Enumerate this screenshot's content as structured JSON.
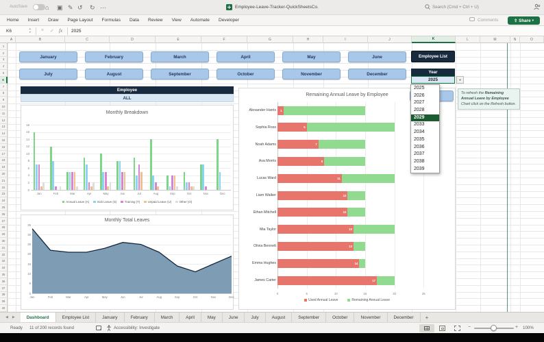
{
  "titlebar": {
    "autosave": "AutoSave",
    "title": "Employee-Leave-Tracker-QuickSheetsCo.",
    "search": "Search (Cmd + Ctrl + U)"
  },
  "ribbon": {
    "tabs": [
      "Home",
      "Insert",
      "Draw",
      "Page Layout",
      "Formulas",
      "Data",
      "Review",
      "View",
      "Automate",
      "Developer"
    ],
    "comments": "Comments",
    "share": "Share"
  },
  "formula_bar": {
    "cell_ref": "K6",
    "fx": "fx",
    "value": "2025"
  },
  "grid": {
    "columns": [
      "A",
      "B",
      "C",
      "D",
      "E",
      "F",
      "G",
      "H",
      "I",
      "J",
      "K",
      "L",
      "M",
      "N",
      "O"
    ],
    "rows": 40,
    "selected_column": "K",
    "selected_row": 6
  },
  "controls": {
    "month_buttons_row1": [
      "January",
      "February",
      "March",
      "April",
      "May",
      "June"
    ],
    "month_buttons_row2": [
      "July",
      "August",
      "September",
      "October",
      "November",
      "December"
    ],
    "employee_list_button": "Employee List",
    "year_label": "Year",
    "year_value": "2025",
    "year_options": [
      "2025",
      "2026",
      "2027",
      "2028",
      "2029",
      "2033",
      "2034",
      "2035",
      "2036",
      "2037",
      "2038",
      "2039"
    ],
    "year_selected_option": "2029",
    "refresh_note": {
      "pre": "To refresh the ",
      "bold": "Remaining Annual Leave by Employee",
      "post": " Chart click on the Refresh button."
    }
  },
  "employee_filter": {
    "header": "Employee",
    "value": "ALL"
  },
  "chart_data": [
    {
      "type": "bar",
      "title": "Monthly Breakdown",
      "categories": [
        "Jan",
        "Feb",
        "Mar",
        "Apr",
        "May",
        "Jun",
        "Jul",
        "Aug",
        "Sep",
        "Oct",
        "Nov",
        "Dec"
      ],
      "series": [
        {
          "name": "Annual Leave (A)",
          "color": "#7DD687",
          "values": [
            16,
            12,
            5,
            9,
            10,
            8,
            9,
            14,
            4,
            5,
            7,
            14
          ]
        },
        {
          "name": "Sick Leave (S)",
          "color": "#8FD2F4",
          "values": [
            7,
            8,
            5,
            7,
            5,
            8,
            4,
            4,
            1,
            2,
            7,
            5
          ]
        },
        {
          "name": "Training (T)",
          "color": "#D784D1",
          "values": [
            7,
            1,
            5,
            2,
            5,
            5,
            7,
            2,
            4,
            2,
            1,
            0
          ]
        },
        {
          "name": "Unpaid Leave (U)",
          "color": "#F3BF8C",
          "values": [
            1,
            0,
            5,
            1,
            1,
            5,
            5,
            1,
            4,
            1,
            0,
            0
          ]
        },
        {
          "name": "Other (O)",
          "color": "#DEDEDE",
          "values": [
            2,
            1,
            1,
            2,
            2,
            0,
            0,
            0,
            1,
            1,
            0,
            0
          ]
        }
      ],
      "ylim": [
        0,
        18
      ],
      "ytick_step": 2,
      "grid": true,
      "legend_position": "bottom"
    },
    {
      "type": "area",
      "title": "Monthly Total Leaves",
      "categories": [
        "Jan",
        "Feb",
        "Mar",
        "Apr",
        "May",
        "Jun",
        "Jul",
        "Aug",
        "Sep",
        "Oct",
        "Nov",
        "Dec"
      ],
      "values": [
        33,
        22,
        21,
        21,
        23,
        26,
        25,
        21,
        14,
        11,
        15,
        19
      ],
      "ylim": [
        0,
        35
      ],
      "ytick_step": 5,
      "grid": true,
      "fill_color": "#7E9CB4",
      "line_color": "#15293D"
    },
    {
      "type": "bar-horizontal-stacked",
      "title": "Remaining Annual Leave by Employee",
      "categories": [
        "Alexander Harris",
        "Sophia Ross",
        "Noah Adams",
        "Ava Morris",
        "Lucas Ward",
        "Liam Walker",
        "Ethan Mitchell",
        "Mia Taylor",
        "Olivia Bennett",
        "Emma Hughes",
        "James Carter"
      ],
      "series": [
        {
          "name": "Used Annual Leave",
          "color": "#E8756C",
          "values": [
            1,
            5,
            7,
            8,
            11,
            12,
            12,
            13,
            13,
            14,
            17
          ],
          "data_labels": true
        },
        {
          "name": "Remaining Annual Leave",
          "color": "#90DB8F",
          "values": [
            14,
            15,
            8,
            7,
            9,
            3,
            3,
            7,
            2,
            1,
            3
          ]
        }
      ],
      "xlim": [
        0,
        25
      ],
      "xtick_step": 5,
      "grid": true,
      "legend_position": "bottom"
    }
  ],
  "sheet_tabs": {
    "tabs": [
      "Dashboard",
      "Employee List",
      "January",
      "February",
      "March",
      "April",
      "May",
      "June",
      "July",
      "August",
      "September",
      "October",
      "November",
      "December"
    ],
    "active": "Dashboard",
    "add": "+"
  },
  "status_bar": {
    "mode": "Ready",
    "records": "11 of 200 records found",
    "accessibility": "Accessibility: Investigate",
    "zoom": "100%"
  },
  "icons": {
    "home": "⌂",
    "save": "▣",
    "edit": "✎",
    "undo": "↺",
    "redo": "↻",
    "more": "⋯",
    "stepper_up": "▲",
    "stepper_down": "▼",
    "cancel": "×",
    "enter": "✓",
    "dropdown_arrow": "▼",
    "tab_prev": "◀",
    "tab_next": "▶",
    "share_arrow": "▾",
    "share_glyph": "⇧",
    "zoom_minus": "−",
    "zoom_plus": "+"
  },
  "colors": {
    "excel_green": "#1E7145",
    "navy_header": "#182B3E",
    "month_button": "#A9C7E9",
    "all_row": "#D9E6F3",
    "selection_green": "#107C41",
    "dropdown_selected": "#1C5A30",
    "note_bg": "#E9F3EF",
    "pagebreak_green": "#1E7145"
  }
}
